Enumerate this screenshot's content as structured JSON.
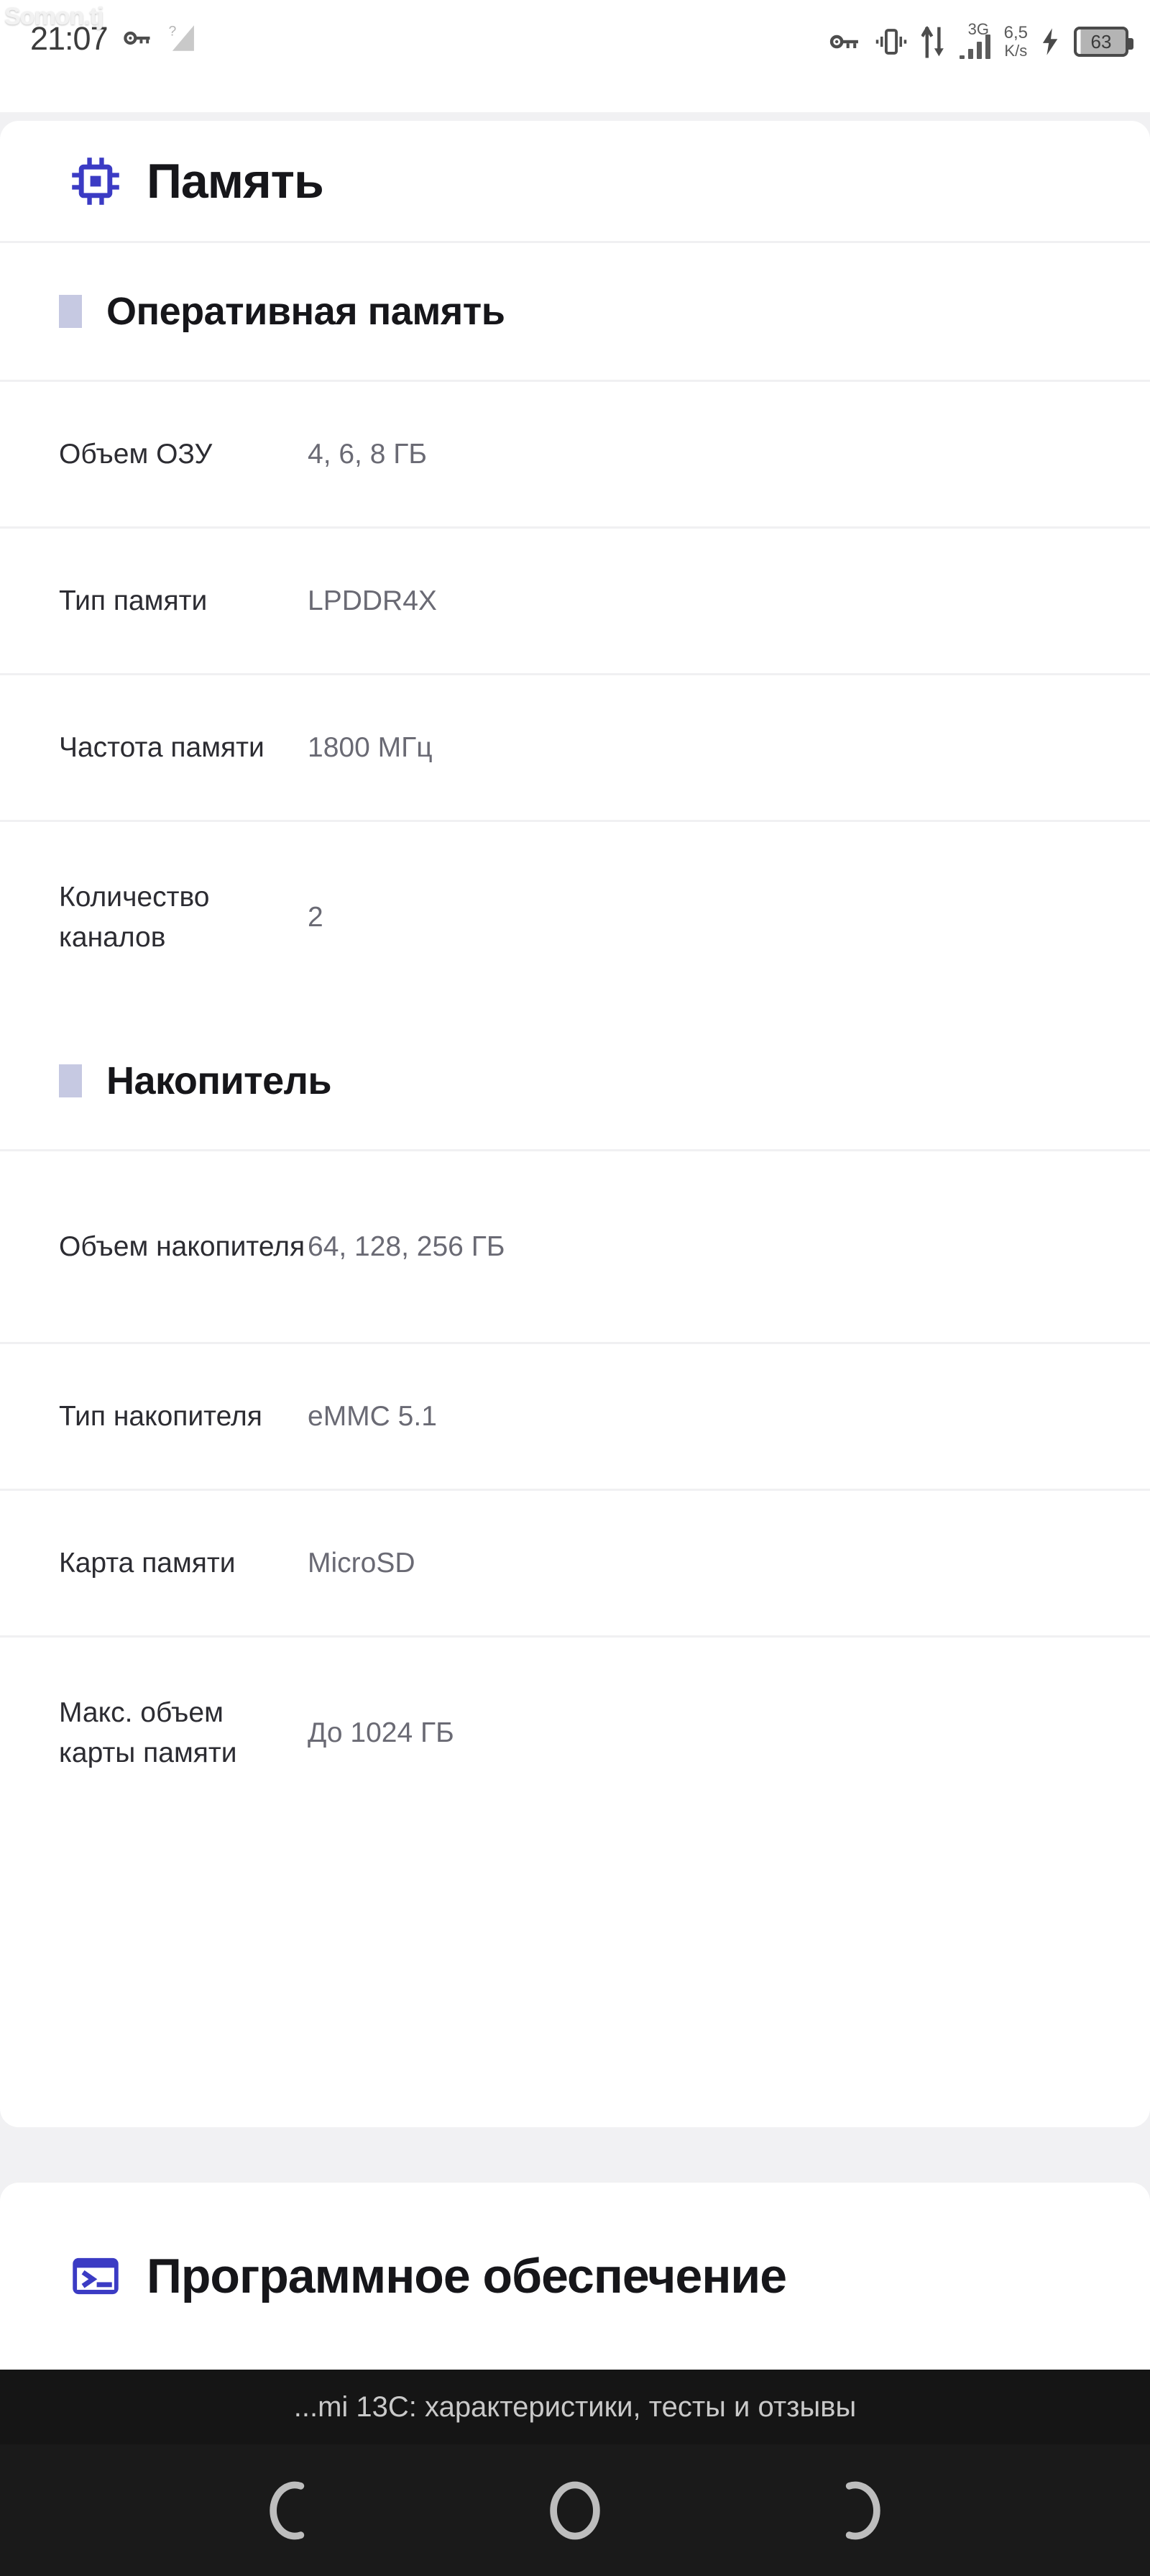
{
  "statusbar": {
    "watermark": "Somon.tj",
    "clock": "21:07",
    "left_icons": [
      "key-icon",
      "signal-unknown-icon"
    ],
    "right_icons": [
      "vpn-key-icon",
      "vibrate-icon",
      "data-transfer-icon"
    ],
    "network_type": "3G",
    "net_speed_value": "6,5",
    "net_speed_unit": "K/s",
    "battery_percent": "63",
    "charging_icon": "charging-bolt-icon"
  },
  "page": {
    "title": "Память",
    "icon": "cpu-chip-icon"
  },
  "sections": [
    {
      "title": "Оперативная память",
      "rows": [
        {
          "label": "Объем ОЗУ",
          "value": "4, 6, 8 ГБ"
        },
        {
          "label": "Тип памяти",
          "value": "LPDDR4X"
        },
        {
          "label": "Частота памяти",
          "value": "1800 МГц"
        },
        {
          "label": "Количество каналов",
          "value": "2"
        }
      ]
    },
    {
      "title": "Накопитель",
      "rows": [
        {
          "label": "Объем накопителя",
          "value": "64, 128, 256 ГБ"
        },
        {
          "label": "Тип накопителя",
          "value": "eMMC 5.1"
        },
        {
          "label": "Карта памяти",
          "value": "MicroSD"
        },
        {
          "label": "Макс. объем карты памяти",
          "value": "До 1024 ГБ"
        }
      ]
    }
  ],
  "software_card": {
    "title": "Программное обеспечение",
    "icon": "terminal-icon"
  },
  "toast": {
    "text": "...mi 13C: характеристики, тесты и отзывы"
  },
  "navbar": {
    "back_label": "back-icon",
    "home_label": "home-icon",
    "recents_label": "recents-icon"
  },
  "colors": {
    "accent_blue": "#3b3bc4",
    "bullet": "#c6c9e2",
    "page_bg": "#f1f1f3",
    "card_bg": "#ffffff",
    "nav_bg": "#1a1a1a"
  }
}
